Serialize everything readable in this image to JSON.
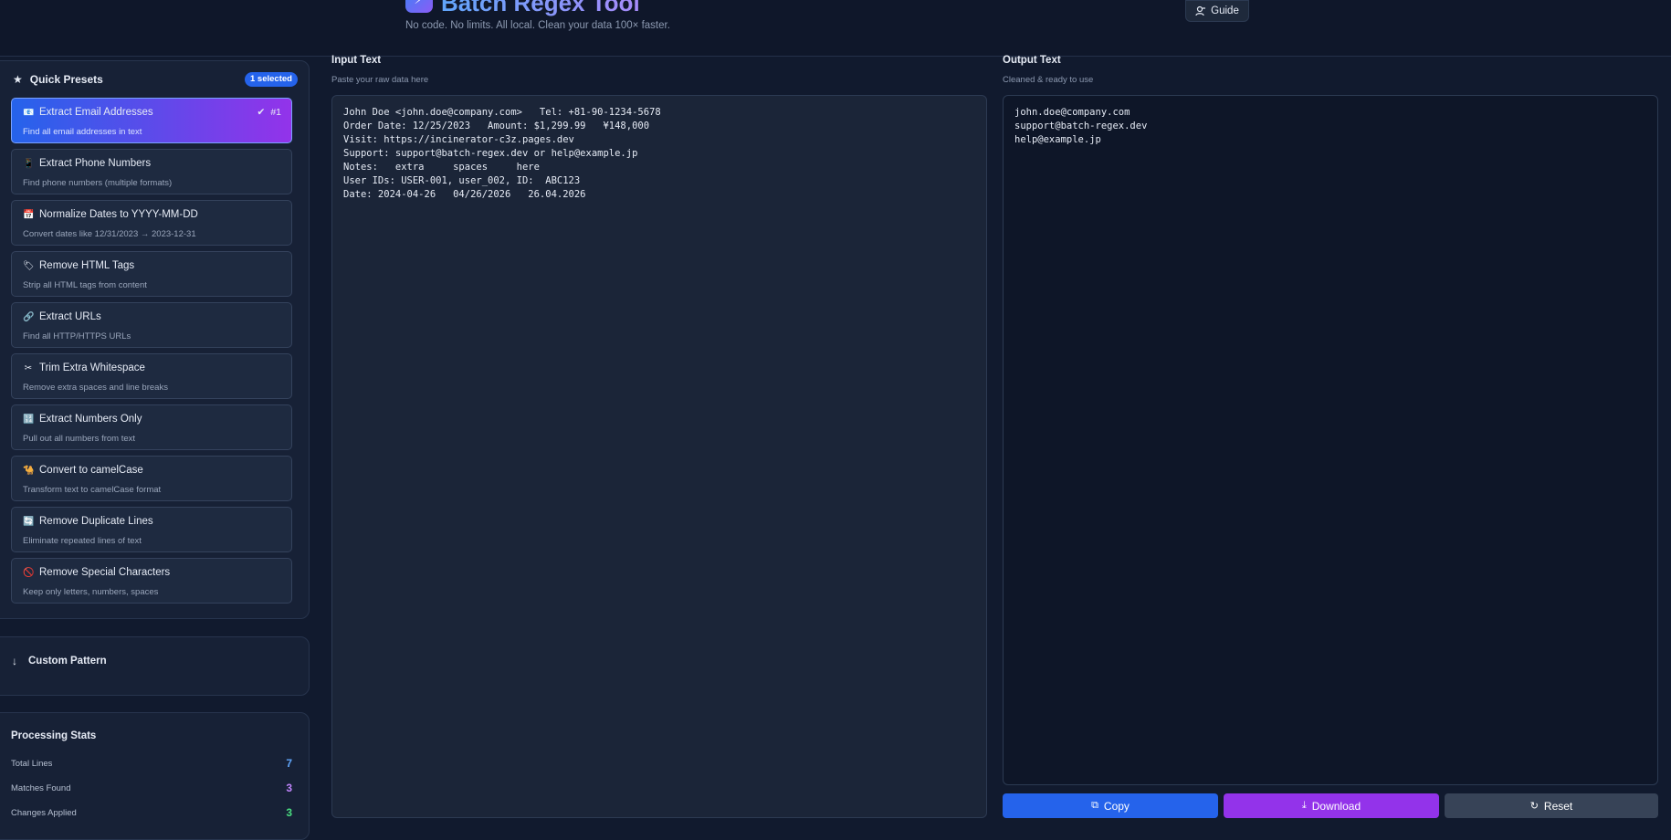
{
  "header": {
    "title": "Batch Regex Tool",
    "subtitle": "No code. No limits. All local. Clean your data 100× faster.",
    "guide_label": "Guide"
  },
  "presets": {
    "heading": "Quick Presets",
    "selected_badge": "1 selected",
    "active_rank": "#1",
    "items": [
      {
        "icon": "📧",
        "title": "Extract Email Addresses",
        "desc": "Find all email addresses in text"
      },
      {
        "icon": "📱",
        "title": "Extract Phone Numbers",
        "desc": "Find phone numbers (multiple formats)"
      },
      {
        "icon": "📅",
        "title": "Normalize Dates to YYYY-MM-DD",
        "desc": "Convert dates like 12/31/2023 → 2023-12-31"
      },
      {
        "icon": "🏷",
        "title": "Remove HTML Tags",
        "desc": "Strip all HTML tags from content"
      },
      {
        "icon": "🔗",
        "title": "Extract URLs",
        "desc": "Find all HTTP/HTTPS URLs"
      },
      {
        "icon": "✂",
        "title": "Trim Extra Whitespace",
        "desc": "Remove extra spaces and line breaks"
      },
      {
        "icon": "🔢",
        "title": "Extract Numbers Only",
        "desc": "Pull out all numbers from text"
      },
      {
        "icon": "🐪",
        "title": "Convert to camelCase",
        "desc": "Transform text to camelCase format"
      },
      {
        "icon": "🔄",
        "title": "Remove Duplicate Lines",
        "desc": "Eliminate repeated lines of text"
      },
      {
        "icon": "🚫",
        "title": "Remove Special Characters",
        "desc": "Keep only letters, numbers, spaces"
      }
    ]
  },
  "custom": {
    "label": "Custom Pattern"
  },
  "stats": {
    "heading": "Processing Stats",
    "rows": [
      {
        "label": "Total Lines",
        "value": "7",
        "color": "#60a5fa"
      },
      {
        "label": "Matches Found",
        "value": "3",
        "color": "#c084fc"
      },
      {
        "label": "Changes Applied",
        "value": "3",
        "color": "#4ade80"
      }
    ]
  },
  "input": {
    "label": "Input Text",
    "hint": "Paste your raw data here",
    "value": "John Doe <john.doe@company.com>   Tel: +81-90-1234-5678\nOrder Date: 12/25/2023   Amount: $1,299.99   ¥148,000\nVisit: https://incinerator-c3z.pages.dev\nSupport: support@batch-regex.dev or help@example.jp\nNotes:   extra     spaces     here\nUser IDs: USER-001, user_002, ID:  ABC123\nDate: 2024-04-26   04/26/2026   26.04.2026"
  },
  "output": {
    "label": "Output Text",
    "hint": "Cleaned & ready to use",
    "value": "john.doe@company.com\nsupport@batch-regex.dev\nhelp@example.jp"
  },
  "actions": {
    "copy": "Copy",
    "download": "Download",
    "reset": "Reset"
  }
}
